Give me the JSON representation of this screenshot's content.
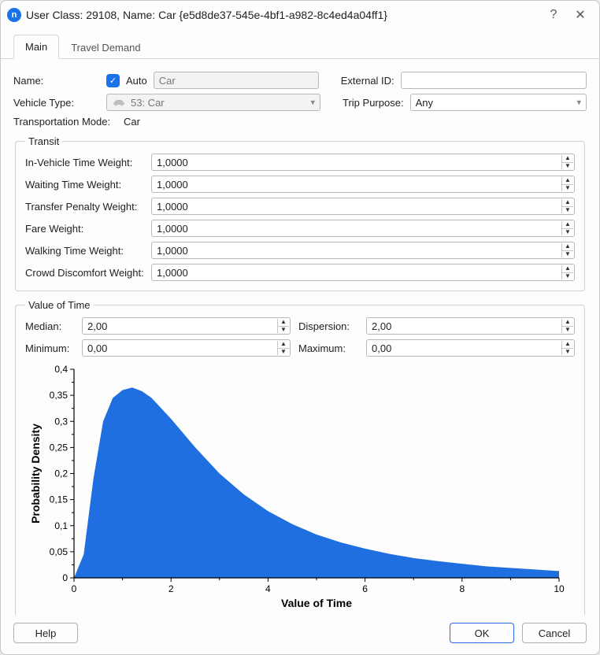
{
  "title": "User Class: 29108, Name: Car  {e5d8de37-545e-4bf1-a982-8c4ed4a04ff1}",
  "tabs": {
    "main": "Main",
    "travel": "Travel Demand"
  },
  "active_tab": "main",
  "fields": {
    "name_label": "Name:",
    "auto_label": "Auto",
    "auto_checked": true,
    "name_value": "Car",
    "external_id_label": "External ID:",
    "external_id_value": "",
    "vehicle_type_label": "Vehicle Type:",
    "vehicle_type_value": "53: Car",
    "trip_purpose_label": "Trip Purpose:",
    "trip_purpose_value": "Any",
    "transport_mode_label": "Transportation Mode:",
    "transport_mode_value": "Car"
  },
  "transit": {
    "legend": "Transit",
    "in_vehicle_label": "In-Vehicle Time Weight:",
    "in_vehicle_value": "1,0000",
    "waiting_label": "Waiting Time Weight:",
    "waiting_value": "1,0000",
    "transfer_label": "Transfer Penalty Weight:",
    "transfer_value": "1,0000",
    "fare_label": "Fare Weight:",
    "fare_value": "1,0000",
    "walking_label": "Walking Time Weight:",
    "walking_value": "1,0000",
    "crowd_label": "Crowd Discomfort Weight:",
    "crowd_value": "1,0000"
  },
  "vot": {
    "legend": "Value of Time",
    "median_label": "Median:",
    "median_value": "2,00",
    "dispersion_label": "Dispersion:",
    "dispersion_value": "2,00",
    "minimum_label": "Minimum:",
    "minimum_value": "0,00",
    "maximum_label": "Maximum:",
    "maximum_value": "0,00"
  },
  "buttons": {
    "help": "Help",
    "ok": "OK",
    "cancel": "Cancel"
  },
  "colors": {
    "accent": "#1a73e8",
    "chart_fill": "#1f6fe0"
  },
  "chart_data": {
    "type": "area",
    "title": "",
    "xlabel": "Value of Time",
    "ylabel": "Probability Density",
    "xlim": [
      0,
      10
    ],
    "ylim": [
      0,
      0.4
    ],
    "xticks": [
      0,
      2,
      4,
      6,
      8,
      10
    ],
    "yticks": [
      0,
      0.05,
      0.1,
      0.15,
      0.2,
      0.25,
      0.3,
      0.35,
      0.4
    ],
    "ytick_labels": [
      "0",
      "0,05",
      "0,1",
      "0,15",
      "0,2",
      "0,25",
      "0,3",
      "0,35",
      "0,4"
    ],
    "series": [
      {
        "name": "pdf",
        "x": [
          0.0,
          0.2,
          0.4,
          0.6,
          0.8,
          1.0,
          1.2,
          1.4,
          1.6,
          1.8,
          2.0,
          2.5,
          3.0,
          3.5,
          4.0,
          4.5,
          5.0,
          5.5,
          6.0,
          6.5,
          7.0,
          7.5,
          8.0,
          8.5,
          9.0,
          9.5,
          10.0
        ],
        "y": [
          0.0,
          0.045,
          0.19,
          0.3,
          0.345,
          0.36,
          0.365,
          0.358,
          0.345,
          0.325,
          0.305,
          0.25,
          0.2,
          0.16,
          0.128,
          0.103,
          0.083,
          0.068,
          0.056,
          0.046,
          0.038,
          0.032,
          0.027,
          0.022,
          0.019,
          0.016,
          0.013
        ]
      }
    ]
  }
}
